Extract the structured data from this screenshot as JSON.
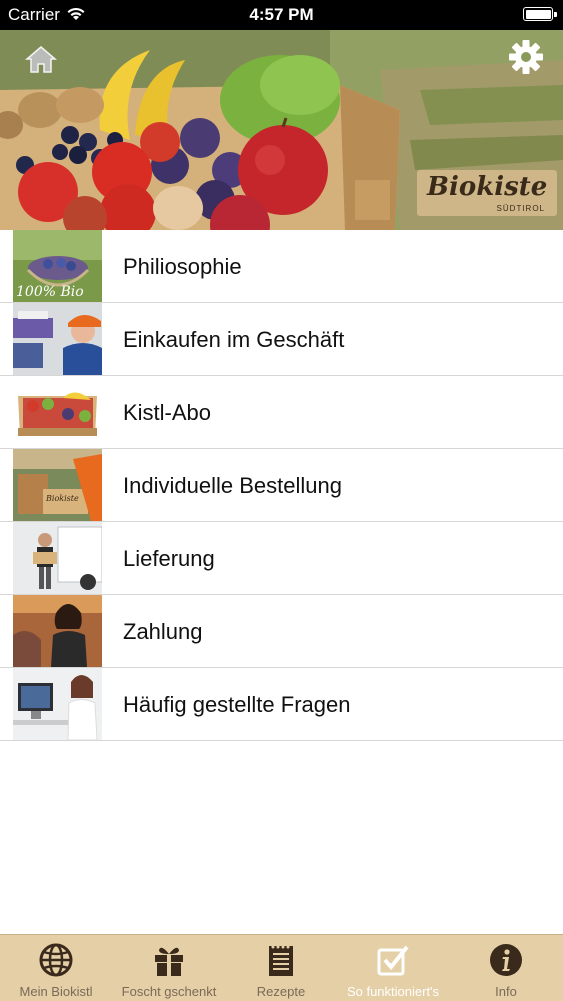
{
  "status_bar": {
    "carrier": "Carrier",
    "time": "4:57 PM"
  },
  "header": {
    "logo_text": "Biokiste",
    "logo_subtext": "SÜDTIROL",
    "home_icon": "home-icon",
    "settings_icon": "gear-icon"
  },
  "menu": {
    "items": [
      {
        "label": "Philiosophie",
        "thumb_text": "100% Bio"
      },
      {
        "label": "Einkaufen im Geschäft"
      },
      {
        "label": "Kistl-Abo"
      },
      {
        "label": "Individuelle Bestellung"
      },
      {
        "label": "Lieferung"
      },
      {
        "label": "Zahlung"
      },
      {
        "label": "Häufig gestellte Fragen"
      }
    ]
  },
  "tabbar": {
    "tabs": [
      {
        "label": "Mein Biokistl",
        "icon": "globe-icon"
      },
      {
        "label": "Foscht gschenkt",
        "icon": "gift-icon"
      },
      {
        "label": "Rezepte",
        "icon": "notepad-icon"
      },
      {
        "label": "So funktioniert's",
        "icon": "checkbox-icon",
        "active": true
      },
      {
        "label": "Info",
        "icon": "info-icon"
      }
    ],
    "active_index": 3
  },
  "colors": {
    "tabbar_bg": "#e5cfa6",
    "tab_inactive": "#7a6a58",
    "tab_active": "#ffffff",
    "status_bar_bg": "#000000"
  }
}
